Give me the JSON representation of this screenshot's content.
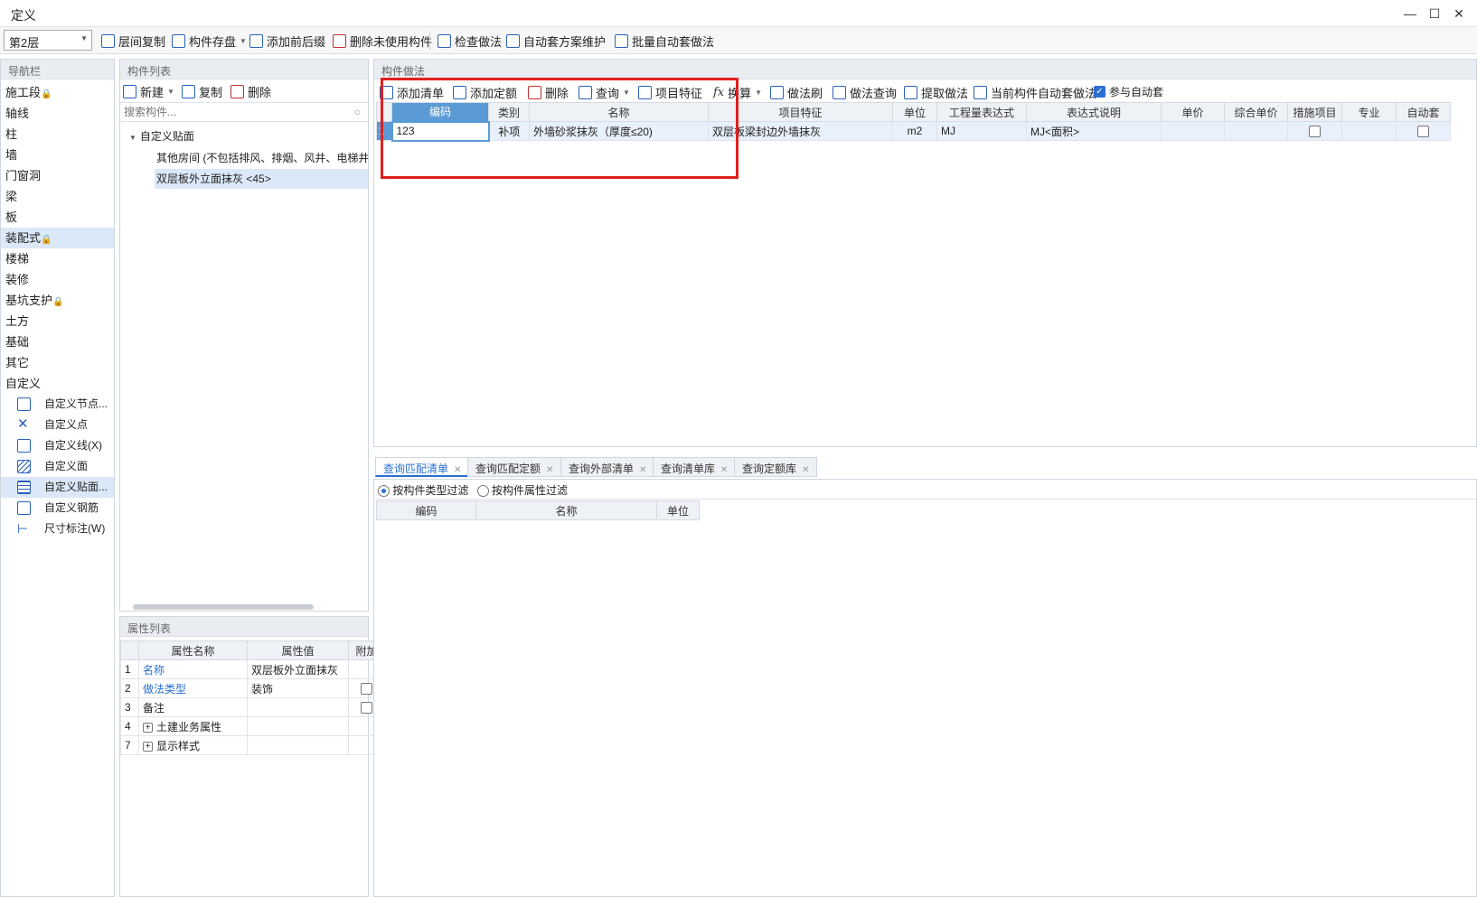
{
  "window": {
    "title": "定义",
    "min": "—",
    "max": "☐",
    "close": "✕"
  },
  "toolbar": {
    "floor": "第2层",
    "items": [
      "层间复制",
      "构件存盘",
      "添加前后缀",
      "删除未使用构件",
      "检查做法",
      "自动套方案维护",
      "批量自动套做法"
    ]
  },
  "nav": {
    "header": "导航栏",
    "items": [
      "施工段",
      "轴线",
      "柱",
      "墙",
      "门窗洞",
      "梁",
      "板",
      "装配式",
      "楼梯",
      "装修",
      "基坑支护",
      "土方",
      "基础",
      "其它",
      "自定义"
    ],
    "lock_glyph": "🔒",
    "sub": [
      "自定义节点...",
      "自定义点",
      "自定义线(X)",
      "自定义面",
      "自定义贴面...",
      "自定义钢筋",
      "尺寸标注(W)"
    ]
  },
  "components": {
    "header": "构件列表",
    "new": "新建",
    "copy": "复制",
    "delete": "删除",
    "search_placeholder": "搜索构件...",
    "tree_root": "自定义贴面",
    "tree_items": [
      "其他房间 (不包括排风、排烟、风井、电梯井",
      "双层板外立面抹灰 <45>"
    ]
  },
  "props": {
    "header": "属性列表",
    "cols": [
      "属性名称",
      "属性值",
      "附加"
    ],
    "rows": [
      {
        "no": "1",
        "name": "名称",
        "value": "双层板外立面抹灰"
      },
      {
        "no": "2",
        "name": "做法类型",
        "value": "装饰"
      },
      {
        "no": "3",
        "name": "备注",
        "value": ""
      },
      {
        "no": "4",
        "name": "土建业务属性",
        "value": ""
      },
      {
        "no": "7",
        "name": "显示样式",
        "value": ""
      }
    ],
    "expand": "+"
  },
  "method": {
    "header": "构件做法",
    "toolbar": [
      "添加清单",
      "添加定额",
      "删除",
      "查询",
      "项目特征",
      "换算",
      "做法刷",
      "做法查询",
      "提取做法",
      "当前构件自动套做法",
      "参与自动套"
    ],
    "fx": "fx",
    "cols": [
      "编码",
      "类别",
      "名称",
      "项目特征",
      "单位",
      "工程量表达式",
      "表达式说明",
      "单价",
      "综合单价",
      "措施项目",
      "专业",
      "自动套"
    ],
    "row": {
      "no": "1",
      "code": "123",
      "type": "补项",
      "name": "外墙砂浆抹灰（厚度≤20)",
      "feature": "双层板梁封边外墙抹灰",
      "unit": "m2",
      "expr": "MJ",
      "desc": "MJ<面积>",
      "price": "",
      "comp": "",
      "spec": ""
    }
  },
  "query": {
    "tabs": [
      "查询匹配清单",
      "查询匹配定额",
      "查询外部清单",
      "查询清单库",
      "查询定额库"
    ],
    "filter1": "按构件类型过滤",
    "filter2": "按构件属性过滤",
    "cols": [
      "编码",
      "名称",
      "单位"
    ]
  },
  "highlight_color": "#e02020",
  "accent": "#2a6fd1"
}
